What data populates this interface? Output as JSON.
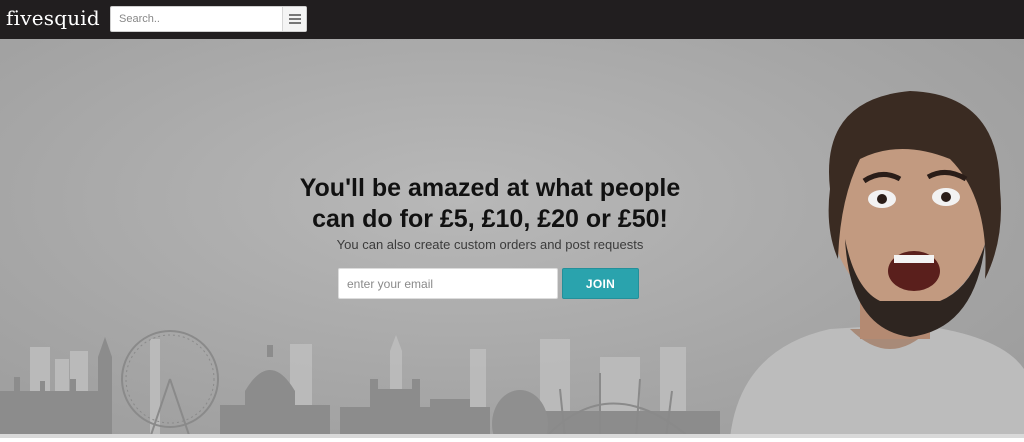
{
  "header": {
    "logo_text": "fivesquid",
    "search": {
      "placeholder": "Search..",
      "value": ""
    },
    "menu_icon": "hamburger-menu-icon"
  },
  "hero": {
    "headline_line1": "You'll be amazed at what people",
    "headline_line2": "can do for £5, £10, £20 or £50!",
    "subline": "You can also create custom orders and post requests",
    "email_placeholder": "enter your email",
    "join_label": "JOIN"
  },
  "colors": {
    "topbar": "#211e1f",
    "accent": "#2aa3ad",
    "hero_bg": "#a9a9a9"
  }
}
